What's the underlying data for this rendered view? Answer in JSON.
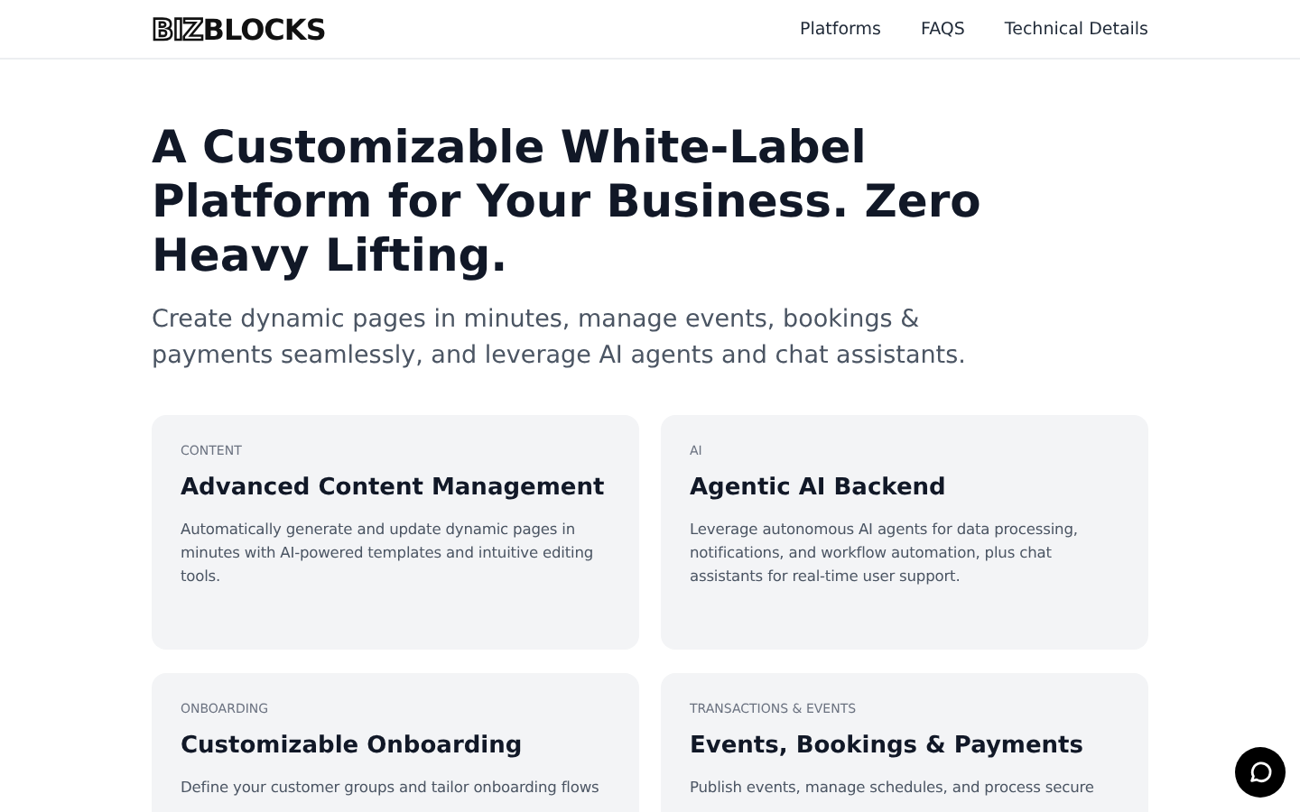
{
  "header": {
    "logo": {
      "outlined": "BIZ",
      "solid": "BLOCKS"
    },
    "nav": [
      "Platforms",
      "FAQS",
      "Technical Details"
    ]
  },
  "hero": {
    "title": "A Customizable White-Label Platform for Your Business. Zero Heavy Lifting.",
    "subtitle": "Create dynamic pages in minutes, manage events, bookings & payments seamlessly, and leverage AI agents and chat assistants."
  },
  "cards": [
    {
      "category": "CONTENT",
      "title": "Advanced Content Management",
      "text": "Automatically generate and update dynamic pages in minutes with AI-powered templates and intuitive editing tools."
    },
    {
      "category": "AI",
      "title": "Agentic AI Backend",
      "text": "Leverage autonomous AI agents for data processing, notifications, and workflow automation, plus chat assistants for real-time user support."
    },
    {
      "category": "ONBOARDING",
      "title": "Customizable Onboarding",
      "text": "Define your customer groups and tailor onboarding flows"
    },
    {
      "category": "TRANSACTIONS & EVENTS",
      "title": "Events, Bookings & Payments",
      "text": "Publish events, manage schedules, and process secure"
    }
  ]
}
